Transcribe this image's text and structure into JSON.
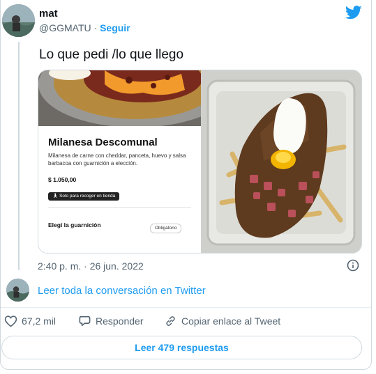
{
  "tweet": {
    "author_name": "mat",
    "handle": "@GGMATU",
    "separator": " · ",
    "follow_label": "Seguir",
    "text": "Lo que pedi /lo que llego",
    "timestamp": "2:40 p. m. · 26 jun. 2022"
  },
  "media": {
    "menu": {
      "title": "Milanesa Descomunal",
      "description": "Milanesa de carne con cheddar, panceta, huevo y salsa barbacoa con guarnición a elección.",
      "price": "$ 1.050,00",
      "badge": "Solo para recoger en tienda",
      "side_label": "Elegí la guarnición",
      "required_label": "Obligatorio"
    }
  },
  "conversation": {
    "link_text": "Leer toda la conversación en Twitter"
  },
  "actions": {
    "likes": "67,2 mil",
    "reply_label": "Responder",
    "copy_label": "Copiar enlace al Tweet"
  },
  "footer": {
    "read_replies_label": "Leer 479 respuestas"
  },
  "colors": {
    "accent": "#1d9bf0",
    "muted": "#536471",
    "border": "#cfd9de"
  },
  "icons": [
    "twitter-bird-icon",
    "info-icon",
    "heart-icon",
    "speech-bubble-icon",
    "link-icon"
  ]
}
